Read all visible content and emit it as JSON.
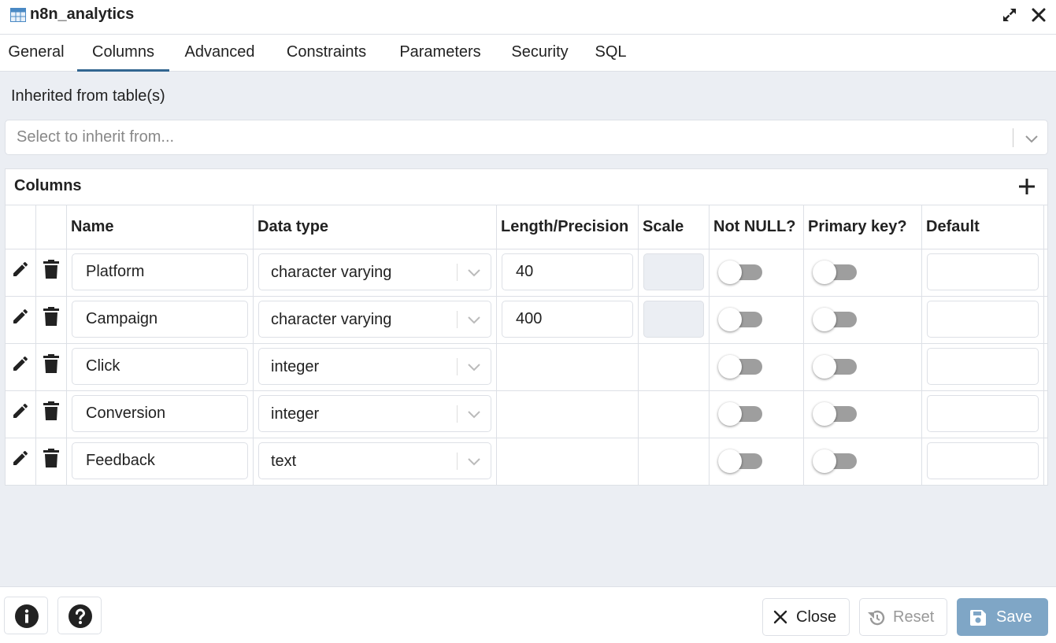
{
  "window": {
    "title": "n8n_analytics"
  },
  "tabs": [
    {
      "label": "General"
    },
    {
      "label": "Columns",
      "active": true
    },
    {
      "label": "Advanced"
    },
    {
      "label": "Constraints"
    },
    {
      "label": "Parameters"
    },
    {
      "label": "Security"
    },
    {
      "label": "SQL"
    }
  ],
  "inherit": {
    "label": "Inherited from table(s)",
    "placeholder": "Select to inherit from..."
  },
  "columns_panel": {
    "title": "Columns",
    "headers": {
      "name": "Name",
      "data_type": "Data type",
      "length": "Length/Precision",
      "scale": "Scale",
      "not_null": "Not NULL?",
      "primary_key": "Primary key?",
      "default": "Default"
    },
    "rows": [
      {
        "name": "Platform",
        "data_type": "character varying",
        "length": "40",
        "not_null": false,
        "primary_key": false,
        "default": ""
      },
      {
        "name": "Campaign",
        "data_type": "character varying",
        "length": "400",
        "not_null": false,
        "primary_key": false,
        "default": ""
      },
      {
        "name": "Click",
        "data_type": "integer",
        "not_null": false,
        "primary_key": false,
        "default": ""
      },
      {
        "name": "Conversion",
        "data_type": "integer",
        "not_null": false,
        "primary_key": false,
        "default": ""
      },
      {
        "name": "Feedback",
        "data_type": "text",
        "not_null": false,
        "primary_key": false,
        "default": ""
      }
    ]
  },
  "footer": {
    "info_icon": "info-icon",
    "help_icon": "help-icon",
    "close_label": "Close",
    "reset_label": "Reset",
    "save_label": "Save"
  },
  "colors": {
    "accent": "#326690",
    "save_button": "#7fa6c6",
    "toggle_off": "#9e9e9e",
    "background": "#ebeef3"
  }
}
